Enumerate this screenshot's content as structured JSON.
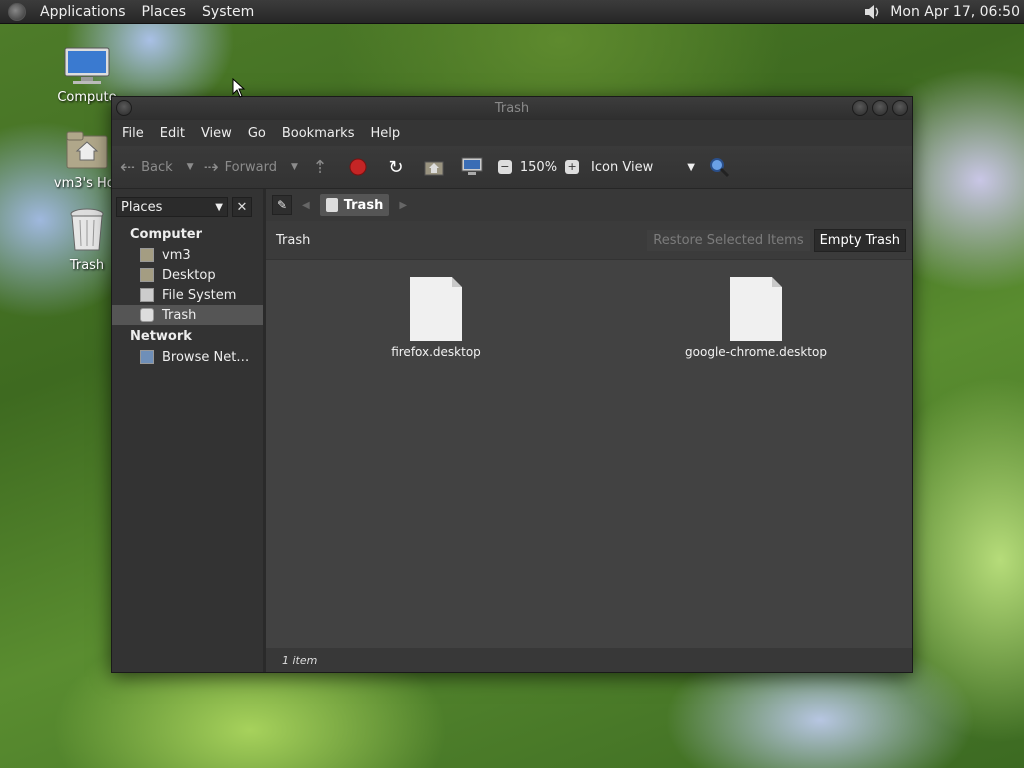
{
  "panel": {
    "menus": [
      "Applications",
      "Places",
      "System"
    ],
    "clock": "Mon Apr 17, 06:50"
  },
  "desktop": {
    "icons": [
      {
        "label": "Compute",
        "icon": "computer-icon"
      },
      {
        "label": "vm3's Hor",
        "icon": "home-folder-icon"
      },
      {
        "label": "Trash",
        "icon": "trash-icon"
      }
    ]
  },
  "window": {
    "title": "Trash",
    "menu": [
      "File",
      "Edit",
      "View",
      "Go",
      "Bookmarks",
      "Help"
    ],
    "toolbar": {
      "back": "Back",
      "forward": "Forward",
      "zoom": "150%",
      "view": "Icon View"
    },
    "sidebar": {
      "selector": "Places",
      "groups": [
        {
          "heading": "Computer",
          "items": [
            "vm3",
            "Desktop",
            "File System",
            "Trash"
          ]
        },
        {
          "heading": "Network",
          "items": [
            "Browse Net…"
          ]
        }
      ]
    },
    "pathbar": {
      "crumb": "Trash"
    },
    "infobar": {
      "location": "Trash",
      "restore_label": "Restore Selected Items",
      "empty_label": "Empty Trash"
    },
    "files": [
      {
        "name": "firefox.desktop"
      },
      {
        "name": "google-chrome.desktop"
      }
    ],
    "status": "1 item"
  }
}
